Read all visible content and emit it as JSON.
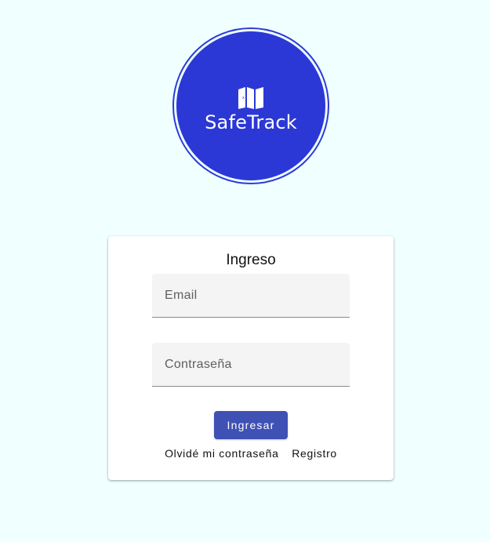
{
  "app": {
    "logo_text": "SafeTrack",
    "logo_icon": "map-icon",
    "colors": {
      "background": "#f0ffff",
      "logo_circle": "#2b38d6",
      "primary_button": "#3f51b5"
    }
  },
  "login": {
    "title": "Ingreso",
    "email": {
      "placeholder": "Email",
      "value": ""
    },
    "password": {
      "placeholder": "Contraseña",
      "value": ""
    },
    "submit_label": "Ingresar",
    "forgot_label": "Olvidé mi contraseña",
    "register_label": "Registro"
  }
}
